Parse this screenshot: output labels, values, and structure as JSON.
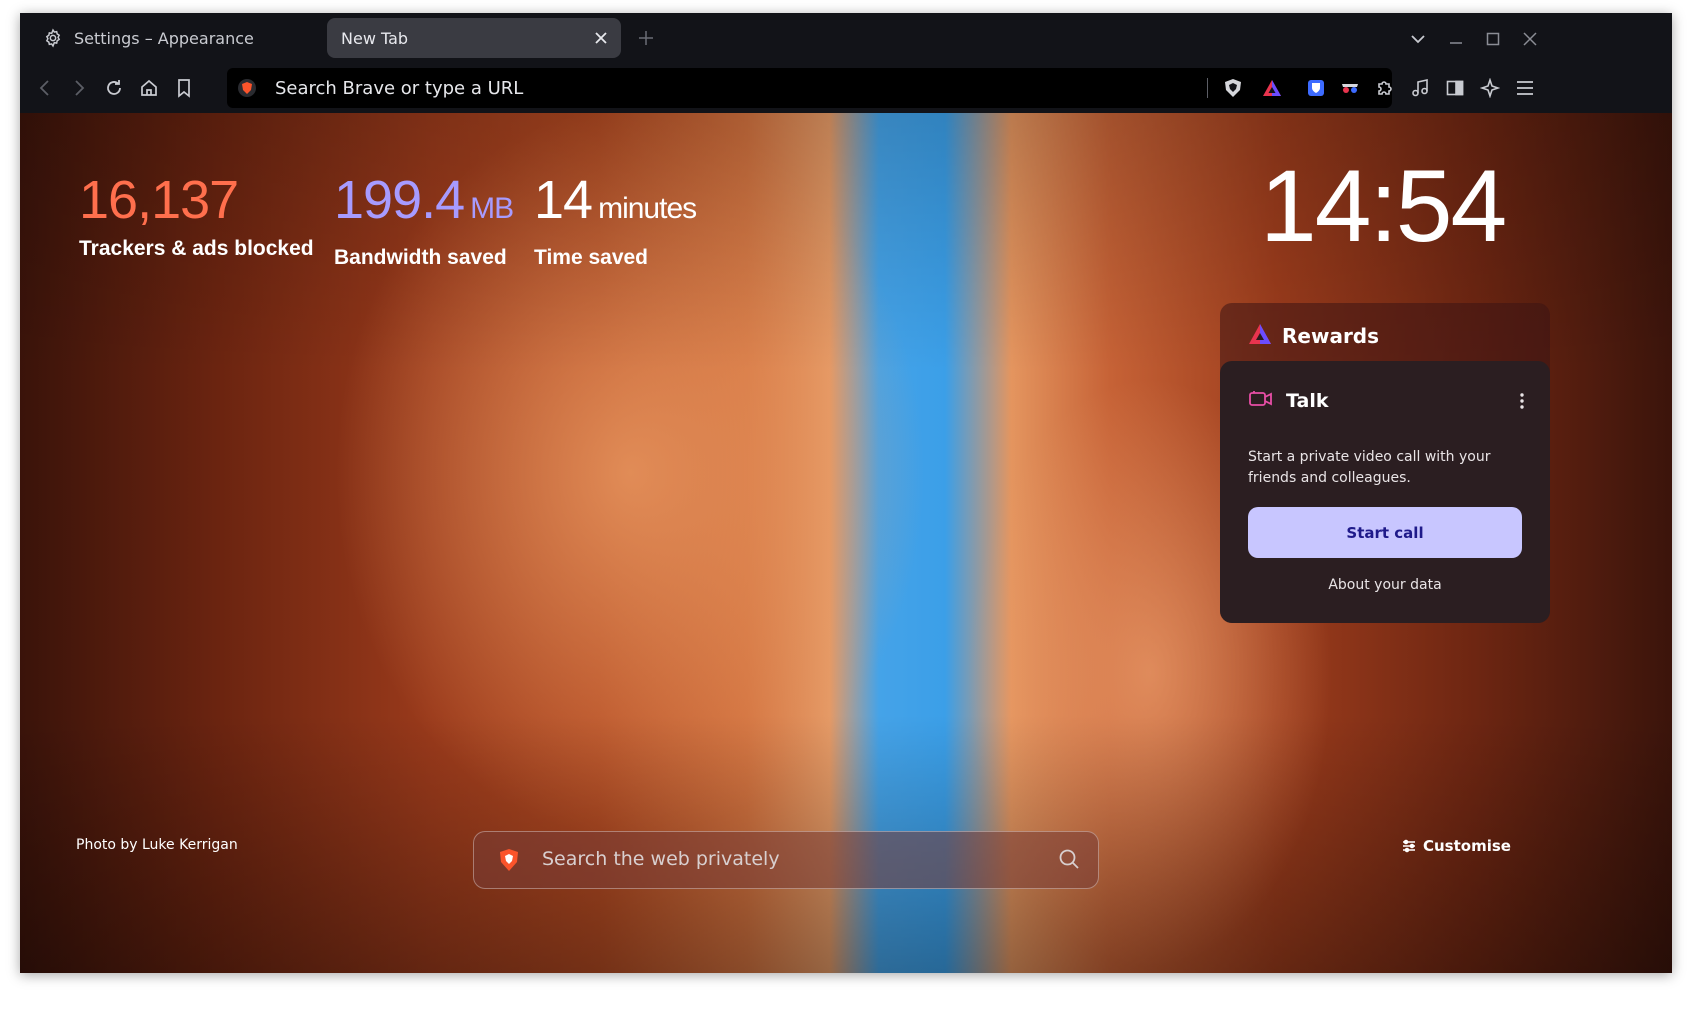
{
  "tabs": [
    {
      "label": "Settings – Appearance",
      "icon": "gear-icon",
      "active": false
    },
    {
      "label": "New Tab",
      "icon": "",
      "active": true
    }
  ],
  "omnibox": {
    "text": "Search Brave or type a URL"
  },
  "stats": {
    "trackers": {
      "value": "16,137",
      "label": "Trackers & ads blocked",
      "color": "#ff6f4d"
    },
    "bandwidth": {
      "value": "199.4",
      "unit": "MB",
      "label": "Bandwidth saved",
      "color": "#a79bff"
    },
    "time": {
      "value": "14",
      "unit": "minutes",
      "label": "Time saved",
      "color": "#ffffff"
    }
  },
  "clock": "14:54",
  "rewards": {
    "title": "Rewards"
  },
  "talk": {
    "title": "Talk",
    "description": "Start a private video call with your friends and colleagues.",
    "button": "Start call",
    "about": "About your data"
  },
  "photo_credit": "Photo by Luke Kerrigan",
  "search": {
    "placeholder": "Search the web privately"
  },
  "customise": "Customise",
  "colors": {
    "accent_button": "#c8c6ff",
    "tab_active": "#3a3b42",
    "chrome_bg": "#121318"
  }
}
